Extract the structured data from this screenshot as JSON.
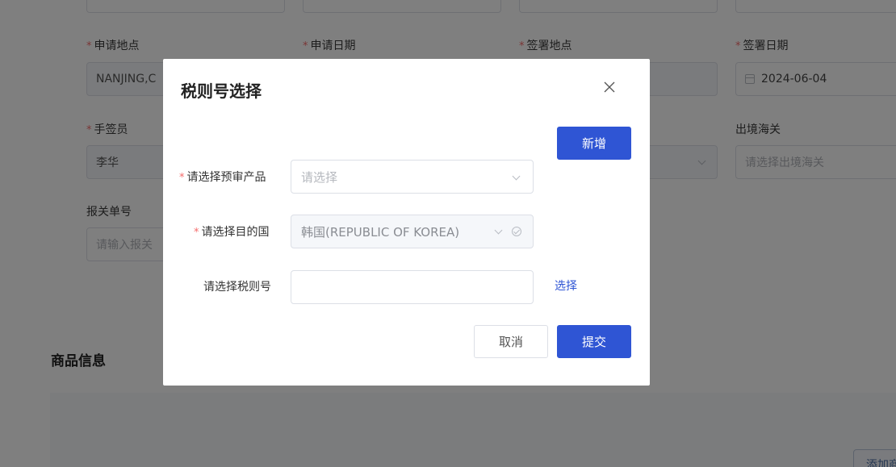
{
  "form": {
    "apply_place": {
      "label": "申请地点",
      "value": "NANJING,C"
    },
    "apply_date": {
      "label": "申请日期"
    },
    "sign_place": {
      "label": "签署地点"
    },
    "sign_date": {
      "label": "签署日期",
      "value": "2024-06-04"
    },
    "signer": {
      "label": "手签员",
      "value": "李华"
    },
    "exit_customs": {
      "label": "出境海关",
      "placeholder": "请选择出境海关"
    },
    "declaration_no": {
      "label": "报关单号",
      "placeholder": "请输入报关"
    },
    "required_mark": "*"
  },
  "goods": {
    "section_title": "商品信息",
    "add_button": "添加商"
  },
  "dialog": {
    "title": "税则号选择",
    "add_button": "新增",
    "product": {
      "label": "请选择预审产品",
      "placeholder": "请选择"
    },
    "destination": {
      "label": "请选择目的国",
      "value": "韩国(REPUBLIC OF KOREA)"
    },
    "tariff": {
      "label": "请选择税则号",
      "value": "",
      "select_link": "选择"
    },
    "cancel_button": "取消",
    "submit_button": "提交"
  }
}
